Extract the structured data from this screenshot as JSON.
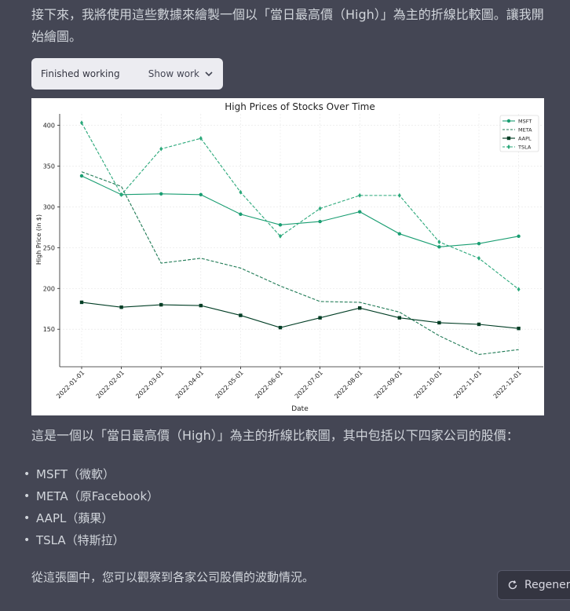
{
  "intro_text": "接下來，我將使用這些數據來繪製一個以「當日最高價（High）」為主的折線比較圖。讓我開始繪圖。",
  "work_panel": {
    "status": "Finished working",
    "toggle_label": "Show work"
  },
  "chart_data": {
    "type": "line",
    "title": "High Prices of Stocks Over Time",
    "xlabel": "Date",
    "ylabel": "High Price (in $)",
    "categories": [
      "2022-01-01",
      "2022-02-01",
      "2022-03-01",
      "2022-04-01",
      "2022-05-01",
      "2022-06-01",
      "2022-07-01",
      "2022-08-01",
      "2022-09-01",
      "2022-10-01",
      "2022-11-01",
      "2022-12-01"
    ],
    "yticks": [
      150,
      200,
      250,
      300,
      350,
      400
    ],
    "ylim": [
      104,
      414
    ],
    "grid": true,
    "legend_position": "top-right",
    "series": [
      {
        "name": "MSFT",
        "style": "solid",
        "marker": "circle",
        "color": "#1a9e72",
        "values": [
          338,
          315,
          316,
          315,
          291,
          278,
          282,
          294,
          267,
          251,
          255,
          264
        ]
      },
      {
        "name": "META",
        "style": "dashed",
        "marker": "none",
        "color": "#1f7a55",
        "values": [
          343,
          325,
          231,
          237,
          225,
          203,
          184,
          183,
          171,
          142,
          119,
          125
        ]
      },
      {
        "name": "AAPL",
        "style": "solid",
        "marker": "square",
        "color": "#003d24",
        "values": [
          183,
          177,
          180,
          179,
          167,
          152,
          164,
          176,
          164,
          158,
          156,
          151
        ]
      },
      {
        "name": "TSLA",
        "style": "dashed",
        "marker": "diamond",
        "color": "#2aa87a",
        "values": [
          403,
          315,
          371,
          384,
          318,
          264,
          298,
          314,
          314,
          257,
          237,
          199
        ]
      }
    ]
  },
  "summary_text": "這是一個以「當日最高價（High）」為主的折線比較圖，其中包括以下四家公司的股價：",
  "companies": [
    {
      "ticker": "MSFT",
      "note": "（微軟）"
    },
    {
      "ticker": "META",
      "note": "（原Facebook）"
    },
    {
      "ticker": "AAPL",
      "note": "（蘋果）"
    },
    {
      "ticker": "TSLA",
      "note": "（特斯拉）"
    }
  ],
  "closing_text": "從這張圖中，您可以觀察到各家公司股價的波動情況。",
  "regenerate_label": "Regenera"
}
